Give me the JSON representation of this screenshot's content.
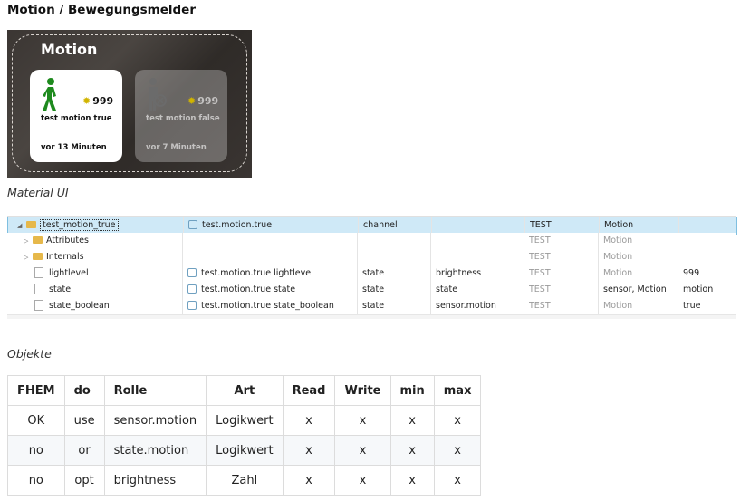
{
  "page_title": "Motion / Bewegungsmelder",
  "widget": {
    "title": "Motion",
    "cards": [
      {
        "name": "test motion true",
        "value": "999",
        "ago": "vor 13 Minuten",
        "state": "active"
      },
      {
        "name": "test motion false",
        "value": "999",
        "ago": "vor 7 Minuten",
        "state": "inactive"
      }
    ]
  },
  "material_ui_heading": "Material UI",
  "tree": {
    "rows": [
      {
        "name": "test_motion_true",
        "id": "test.motion.true",
        "type": "channel",
        "role": "",
        "room": "TEST",
        "func": "Motion",
        "value": "",
        "kind": "folder",
        "expanded": true,
        "selected": true,
        "muted": false
      },
      {
        "name": "Attributes",
        "id": "",
        "type": "",
        "role": "",
        "room": "TEST",
        "func": "Motion",
        "value": "",
        "kind": "folder",
        "expanded": false,
        "selected": false,
        "muted": true
      },
      {
        "name": "Internals",
        "id": "",
        "type": "",
        "role": "",
        "room": "TEST",
        "func": "Motion",
        "value": "",
        "kind": "folder",
        "expanded": false,
        "selected": false,
        "muted": true
      },
      {
        "name": "lightlevel",
        "id": "test.motion.true lightlevel",
        "type": "state",
        "role": "brightness",
        "room": "TEST",
        "func": "Motion",
        "value": "999",
        "kind": "file",
        "selected": false,
        "muted": true
      },
      {
        "name": "state",
        "id": "test.motion.true state",
        "type": "state",
        "role": "state",
        "room": "TEST",
        "func": "sensor, Motion",
        "value": "motion",
        "kind": "file",
        "selected": false,
        "muted": false
      },
      {
        "name": "state_boolean",
        "id": "test.motion.true state_boolean",
        "type": "state",
        "role": "sensor.motion",
        "room": "TEST",
        "func": "Motion",
        "value": "true",
        "kind": "file",
        "selected": false,
        "muted": true
      }
    ]
  },
  "objekte_heading": "Objekte",
  "table": {
    "headers": [
      "FHEM",
      "do",
      "Rolle",
      "Art",
      "Read",
      "Write",
      "min",
      "max"
    ],
    "rows": [
      [
        "OK",
        "use",
        "sensor.motion",
        "Logikwert",
        "x",
        "x",
        "x",
        "x"
      ],
      [
        "no",
        "or",
        "state.motion",
        "Logikwert",
        "x",
        "x",
        "x",
        "x"
      ],
      [
        "no",
        "opt",
        "brightness",
        "Zahl",
        "x",
        "x",
        "x",
        "x"
      ]
    ]
  },
  "colors": {
    "active_figure": "#1e8a1e",
    "inactive_figure": "#6b6b6b",
    "selection": "#cfe9f7",
    "badge_dot": "#d1b400"
  }
}
